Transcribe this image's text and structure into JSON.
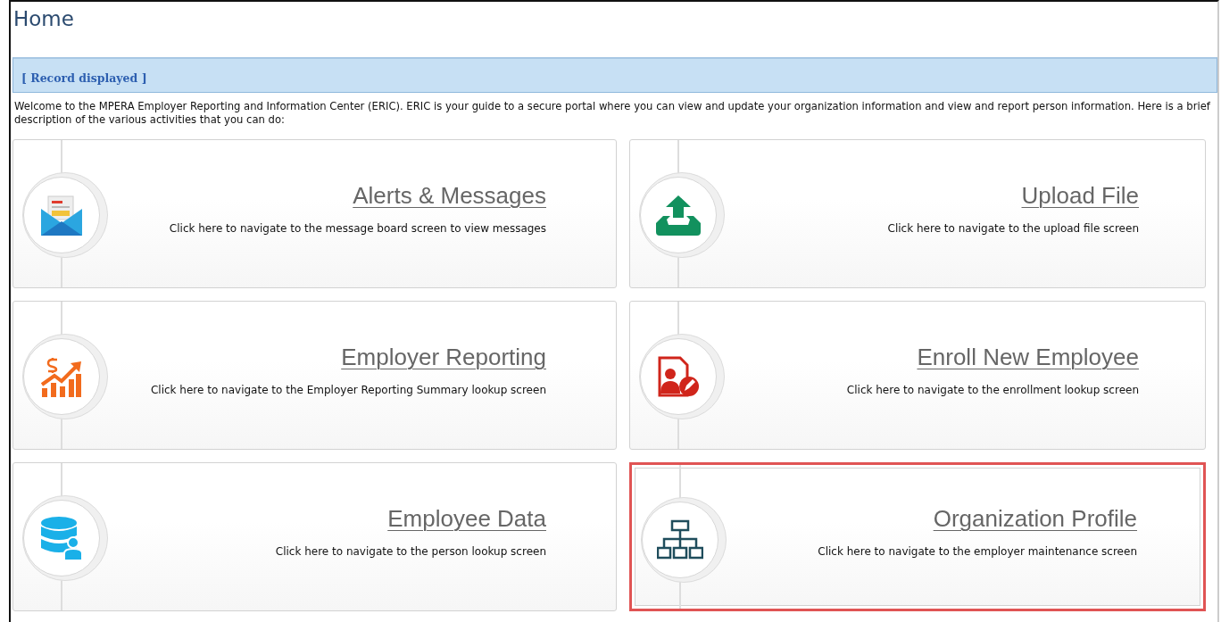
{
  "page": {
    "title": "Home"
  },
  "record_bar": {
    "label": "[ Record displayed ]"
  },
  "intro": "Welcome to the MPERA Employer Reporting and Information Center (ERIC). ERIC is your guide to a secure portal where you can view and update your organization information and view and report person information. Here is a brief description of the various activities that you can do:",
  "tiles": [
    {
      "kind": "messages",
      "title": "Alerts & Messages",
      "description": "Click here to navigate to the message board screen to view messages",
      "highlighted": false
    },
    {
      "kind": "upload",
      "title": "Upload File",
      "description": "Click here to navigate to the upload file screen",
      "highlighted": false
    },
    {
      "kind": "reporting",
      "title": "Employer Reporting",
      "description": "Click here to navigate to the Employer Reporting Summary lookup screen",
      "highlighted": false
    },
    {
      "kind": "enroll",
      "title": "Enroll New Employee",
      "description": "Click here to navigate to the enrollment lookup screen",
      "highlighted": false
    },
    {
      "kind": "data",
      "title": "Employee Data",
      "description": "Click here to navigate to the person lookup screen",
      "highlighted": false
    },
    {
      "kind": "organization",
      "title": "Organization Profile",
      "description": "Click here to navigate to the employer maintenance screen",
      "highlighted": true
    }
  ]
}
